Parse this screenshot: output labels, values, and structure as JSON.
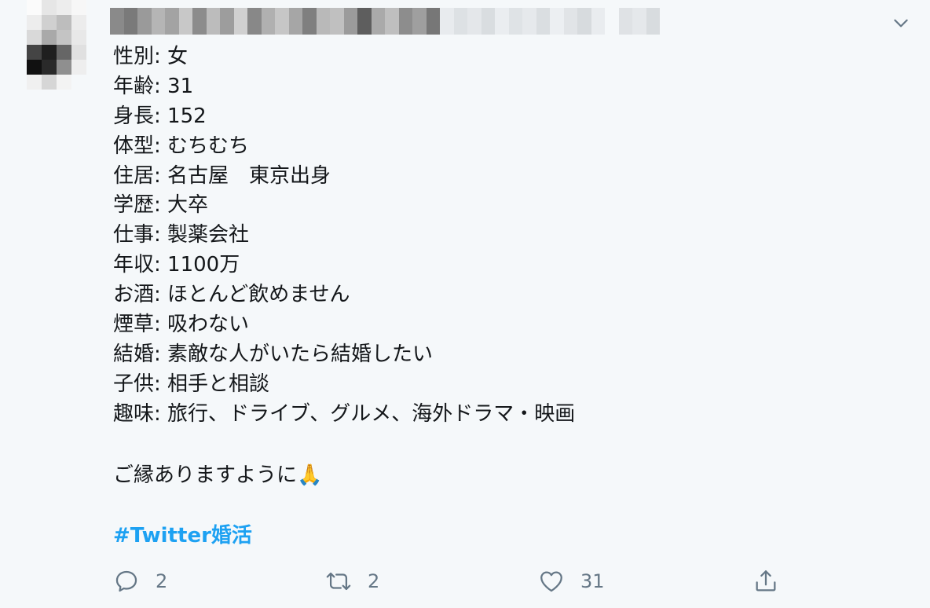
{
  "tweet": {
    "lines": [
      "性別: 女",
      "年齢: 31",
      "身長: 152",
      "体型: むちむち",
      "住居: 名古屋　東京出身",
      "学歴: 大卒",
      "仕事: 製薬会社",
      "年収: 1100万",
      "お酒: ほとんど飲めません",
      "煙草: 吸わない",
      "結婚: 素敵な人がいたら結婚したい",
      "子供: 相手と相談",
      "趣味: 旅行、ドライブ、グルメ、海外ドラマ・映画"
    ],
    "closing": "ご縁ありますように🙏",
    "hashtag": "#Twitter婚活"
  },
  "actions": {
    "reply_count": "2",
    "retweet_count": "2",
    "like_count": "31"
  },
  "icons": {
    "reply": "reply-icon",
    "retweet": "retweet-icon",
    "like": "heart-icon",
    "share": "share-icon",
    "menu": "chevron-down-icon"
  },
  "colors": {
    "hashtag": "#1da1f2",
    "icon_gray": "#657786",
    "background": "#f5f8fa"
  }
}
